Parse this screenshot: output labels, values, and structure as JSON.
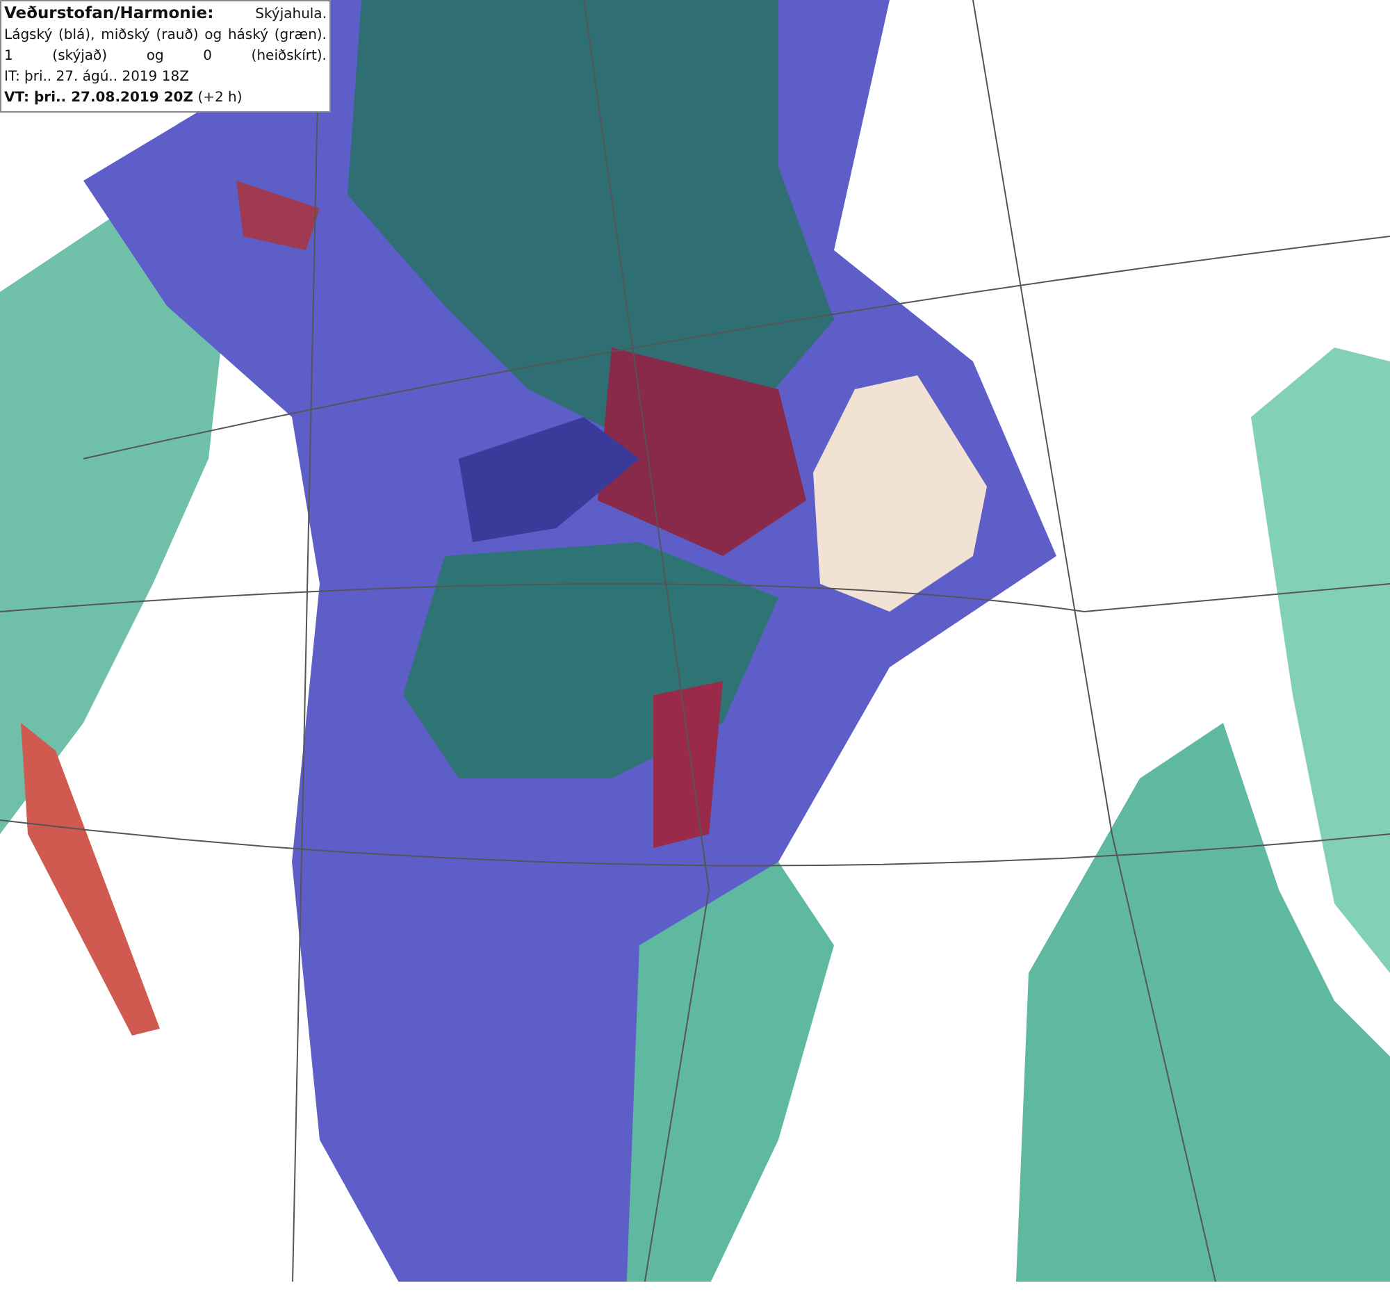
{
  "legend": {
    "title": "Veðurstofan/Harmonie:",
    "subtitle": "Skýjahula.",
    "description_lines": [
      "Lágský (blá), miðský (rauð) og háský (græn).",
      "1 (skýjað) og 0 (heiðskírt)."
    ],
    "issue_time": "IT: þri.. 27. ágú.. 2019 18Z",
    "valid_time": "**VT: þri.. 27.08.2019 20Z** (+2 h)"
  }
}
